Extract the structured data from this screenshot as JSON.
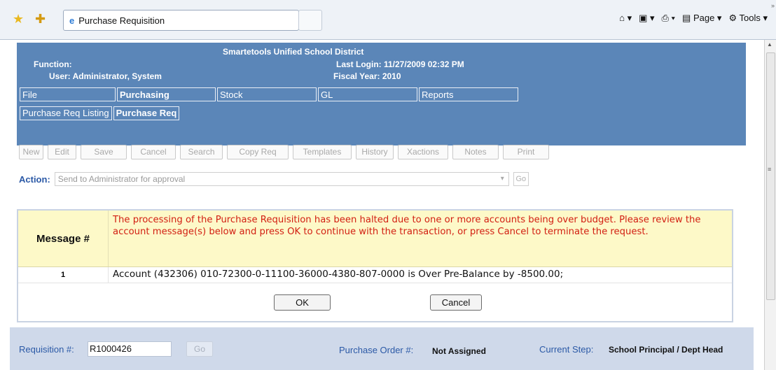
{
  "browser": {
    "tab_title": "Purchase Requisition",
    "page_menu": "Page",
    "tools_menu": "Tools",
    "icons": [
      "favorites-star-icon",
      "add-favorites-icon",
      "ie-page-icon",
      "home-icon",
      "feeds-icon",
      "print-icon",
      "page-icon",
      "tools-gear-icon"
    ]
  },
  "header": {
    "district": "Smartetools Unified School District",
    "function_label": "Function:",
    "user": "User: Administrator, System",
    "last_login": "Last Login: 11/27/2009 02:32 PM",
    "fiscal_year": "Fiscal Year: 2010",
    "bg_color": "#5b86b8"
  },
  "menu": {
    "items": [
      "File",
      "Purchasing",
      "Stock",
      "GL",
      "Reports"
    ],
    "active": "Purchasing"
  },
  "submenu": {
    "items": [
      "Purchase Req Listing",
      "Purchase Req"
    ],
    "active": "Purchase Req"
  },
  "toolbar": {
    "buttons": [
      "New",
      "Edit",
      "Save",
      "Cancel",
      "Search",
      "Copy Req",
      "Templates",
      "History",
      "Xactions",
      "Notes",
      "Print"
    ]
  },
  "action": {
    "label": "Action:",
    "selected": "Send to Administrator for approval",
    "go_label": "Go"
  },
  "message": {
    "header": "Message #",
    "text": "The processing of the Purchase Requisition has been halted due to one or more accounts being over budget. Please review the account message(s) below and press OK to continue with the transaction, or press Cancel to terminate the request.",
    "number": "1",
    "account_text": "Account (432306) 010-72300-0-11100-36000-4380-807-0000 is Over Pre-Balance by -8500.00;",
    "ok_label": "OK",
    "cancel_label": "Cancel"
  },
  "requisition": {
    "req_label": "Requisition #:",
    "req_value": "R1000426",
    "go_label": "Go",
    "po_label": "Purchase Order #:",
    "po_value": "Not Assigned",
    "step_label": "Current Step:",
    "step_value": "School Principal / Dept Head"
  }
}
